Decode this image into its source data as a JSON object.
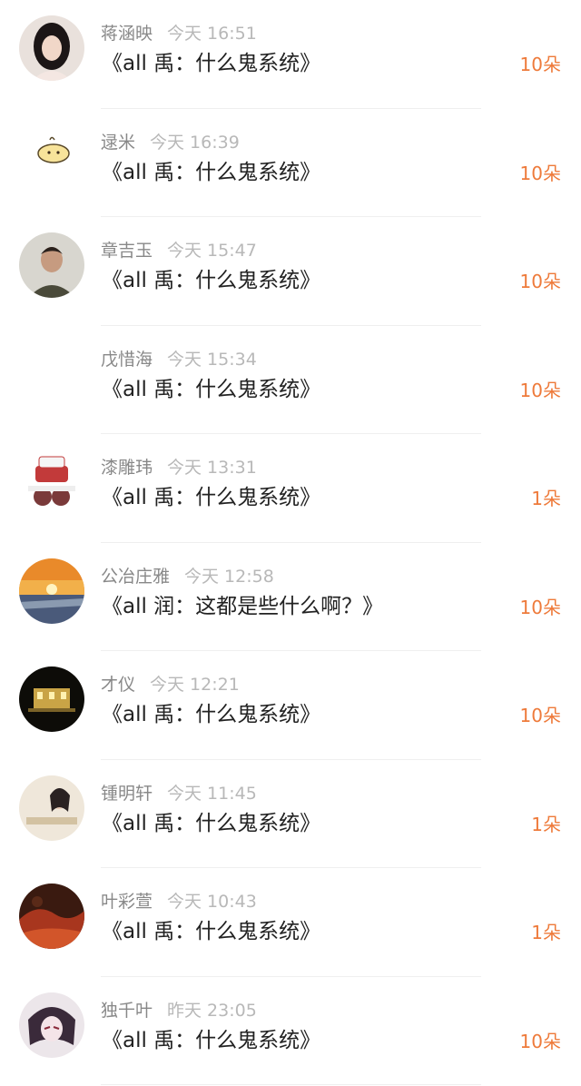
{
  "colors": {
    "name": "#888888",
    "time": "#b8b8b8",
    "title": "#222222",
    "gift": "#ee7a3a",
    "divider": "#efefef"
  },
  "entries": [
    {
      "name": "蒋涵映",
      "time": "今天 16:51",
      "title": "《all 禹：什么鬼系统》",
      "gift": "10朵",
      "avatar": "portrait-woman"
    },
    {
      "name": "逯米",
      "time": "今天 16:39",
      "title": "《all 禹：什么鬼系统》",
      "gift": "10朵",
      "avatar": "cartoon-bun"
    },
    {
      "name": "章吉玉",
      "time": "今天 15:47",
      "title": "《all 禹：什么鬼系统》",
      "gift": "10朵",
      "avatar": "portrait-man"
    },
    {
      "name": "戊惜海",
      "time": "今天 15:34",
      "title": "《all 禹：什么鬼系统》",
      "gift": "10朵",
      "avatar": "none"
    },
    {
      "name": "漆雕玮",
      "time": "今天 13:31",
      "title": "《all 禹：什么鬼系统》",
      "gift": "1朵",
      "avatar": "cake-figures"
    },
    {
      "name": "公冶庄雅",
      "time": "今天 12:58",
      "title": "《all 润：这都是些什么啊？》",
      "gift": "10朵",
      "avatar": "sunset-sea"
    },
    {
      "name": "才仪",
      "time": "今天 12:21",
      "title": "《all 禹：什么鬼系统》",
      "gift": "10朵",
      "avatar": "lit-building"
    },
    {
      "name": "锺明轩",
      "time": "今天 11:45",
      "title": "《all 禹：什么鬼系统》",
      "gift": "1朵",
      "avatar": "girl-text"
    },
    {
      "name": "叶彩萱",
      "time": "今天 10:43",
      "title": "《all 禹：什么鬼系统》",
      "gift": "1朵",
      "avatar": "red-landscape"
    },
    {
      "name": "独千叶",
      "time": "昨天 23:05",
      "title": "《all 禹：什么鬼系统》",
      "gift": "10朵",
      "avatar": "anime-character"
    }
  ]
}
